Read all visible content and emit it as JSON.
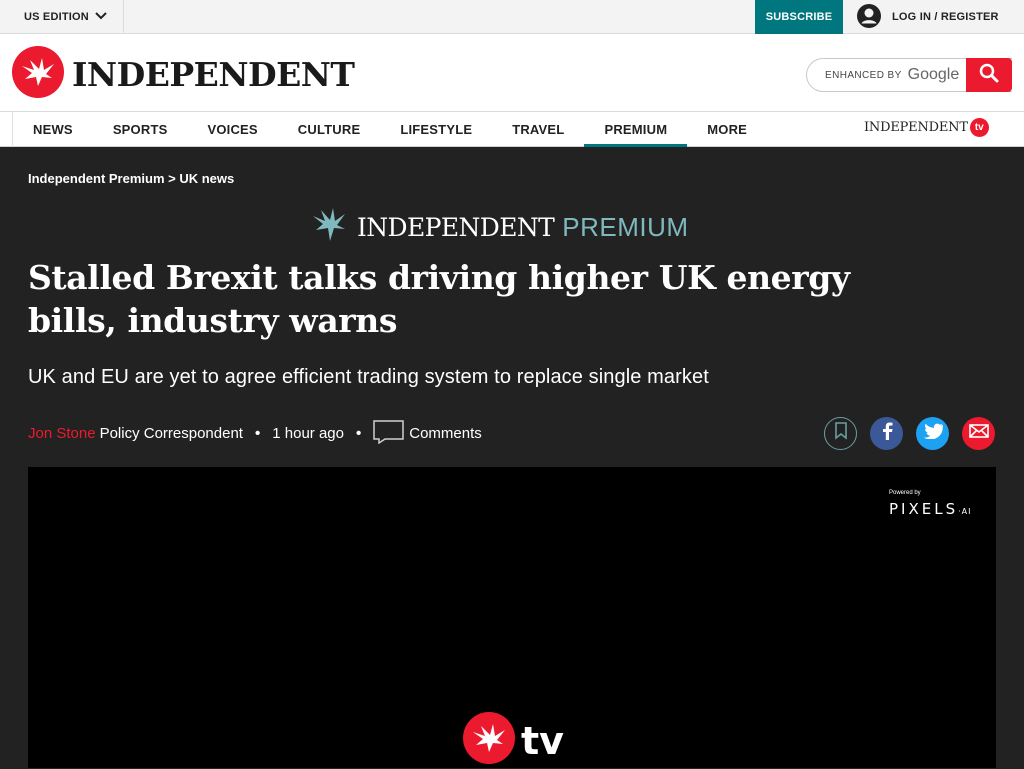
{
  "topbar": {
    "edition": "US EDITION",
    "subscribe": "SUBSCRIBE",
    "login": "LOG IN / REGISTER"
  },
  "masthead": {
    "logo_text": "INDEPENDENT",
    "search_label": "ENHANCED BY",
    "search_brand": "Google"
  },
  "nav": {
    "items": [
      "NEWS",
      "SPORTS",
      "VOICES",
      "CULTURE",
      "LIFESTYLE",
      "TRAVEL",
      "PREMIUM",
      "MORE"
    ],
    "active": "PREMIUM",
    "tv_logo_text": "INDEPENDENT",
    "tv_badge": "tv"
  },
  "article": {
    "breadcrumb": "Independent Premium > UK news",
    "section_brand_1": "INDEPENDENT",
    "section_brand_2": "PREMIUM",
    "headline": "Stalled Brexit talks driving higher UK energy bills, industry warns",
    "standfirst": "UK and EU are yet to agree efficient trading system to replace single market",
    "author": "Jon Stone",
    "author_role": "Policy Correspondent",
    "time": "1 hour ago",
    "comments": "Comments"
  },
  "player": {
    "powered_by": "Powered by",
    "pixels": "PIXELS",
    "pixels_suffix": "·AI",
    "tv_label": "tv"
  },
  "colors": {
    "brand_red": "#ec1a2e",
    "teal": "#00767e",
    "page_bg": "#222222"
  }
}
